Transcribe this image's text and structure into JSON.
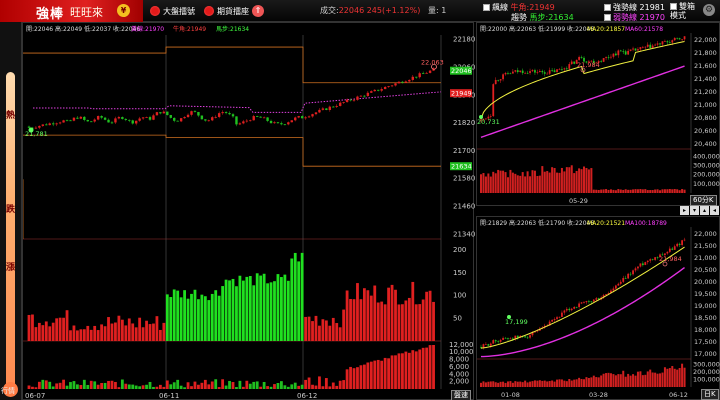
{
  "header": {
    "brand": "強棒",
    "brand_sub": "旺旺來",
    "btn_market": "大盤擂號",
    "btn_futures": "期貨擂座",
    "quote_label": "成交:",
    "quote_value": "22046 245(+1.12%)",
    "volume_label": "量:",
    "volume_value": "1",
    "legend": {
      "left1": "飆線",
      "left1_label": "牛角:21949",
      "left2": "趨勢",
      "left2_label": "馬步:21634",
      "right1_label": "強勢線 21981",
      "right2_label": "弱勢線 21970",
      "mode_label": "雙箱模式"
    },
    "colors": {
      "accent": "#e21a1a",
      "brand_bg": "#c40f0f"
    }
  },
  "thermo": {
    "labels": [
      "熱",
      "跌",
      "漲"
    ],
    "bottom_label": "行情"
  },
  "main_chart": {
    "header": "開:22046 高:22049 低:22037 收:22046",
    "header_tags": [
      {
        "text": "黃線:21970",
        "color": "#ff40ff"
      },
      {
        "text": "牛角:21949",
        "color": "#ff4040"
      },
      {
        "text": "馬步:21634",
        "color": "#40ff40"
      }
    ],
    "y_ticks": [
      "22180",
      "22060",
      "21940",
      "21820",
      "21700",
      "21580",
      "21460",
      "21340"
    ],
    "price_tags": [
      {
        "text": "22046",
        "color": "#20c020",
        "value": 22046
      },
      {
        "text": "21949",
        "color": "#e02020",
        "value": 21949
      },
      {
        "text": "21634",
        "color": "#20c020",
        "value": 21634
      }
    ],
    "annotations": {
      "high": "22,063",
      "low": "21,781"
    },
    "x_ticks": [
      "06-07",
      "06-11",
      "06-12"
    ],
    "ind1_ticks": [
      "200",
      "150",
      "100",
      "50"
    ],
    "ind2_ticks": [
      "12,000",
      "10,000",
      "8,000",
      "6,000",
      "4,000",
      "2,000"
    ],
    "speed_button": "盤速"
  },
  "daily_chart": {
    "header": "開:22000 高:22063 低:21999 收:22046",
    "header_tags": [
      {
        "text": "MA20:21857",
        "color": "#ffff40"
      },
      {
        "text": "MA60:21578",
        "color": "#ff40ff"
      }
    ],
    "y_ticks": [
      "22,000",
      "21,800",
      "21,600",
      "21,400",
      "21,200",
      "21,000",
      "20,800",
      "20,600",
      "20,400"
    ],
    "vol_ticks": [
      "400,000",
      "300,000",
      "200,000",
      "100,000"
    ],
    "annotations": {
      "high": "21,984",
      "low": "20,731"
    },
    "x_ticks": [
      "05-29"
    ],
    "period_button": "60分K"
  },
  "weekly_chart": {
    "header": "開:21829 高:22063 低:21790 收:22046",
    "header_tags": [
      {
        "text": "MA20:21521",
        "color": "#ffff40"
      },
      {
        "text": "MA100:18789",
        "color": "#ff40ff"
      }
    ],
    "y_ticks": [
      "22,000",
      "21,500",
      "21,000",
      "20,500",
      "20,000",
      "19,500",
      "19,000",
      "18,500",
      "18,000",
      "17,500",
      "17,000"
    ],
    "vol_ticks": [
      "300,000",
      "200,000",
      "100,000"
    ],
    "annotations": {
      "high": "21,984",
      "low": "17,199"
    },
    "x_ticks": [
      "01-08",
      "03-28",
      "06-12"
    ],
    "period_button": "日K"
  }
}
